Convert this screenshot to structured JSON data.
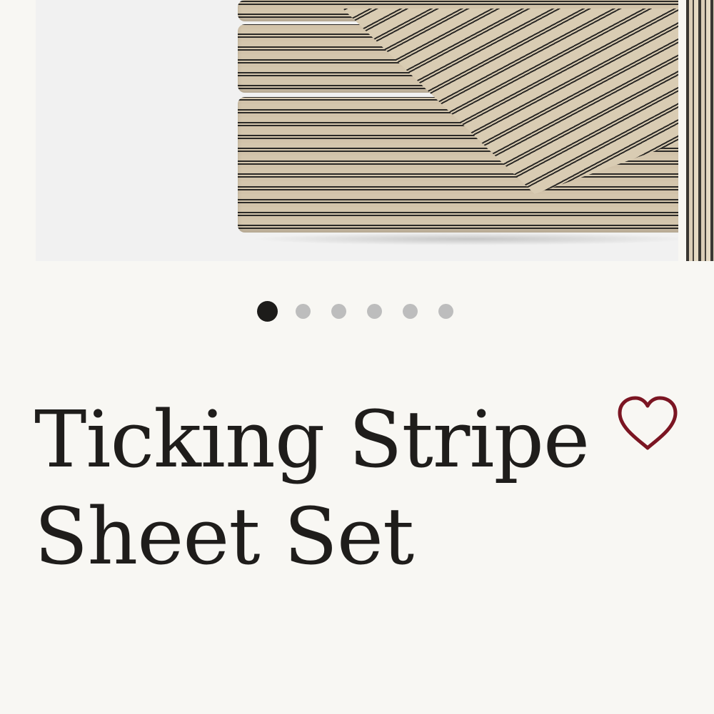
{
  "product": {
    "title": "Ticking Stripe Sheet Set"
  },
  "carousel": {
    "image_description": "Folded ticking stripe sheet set",
    "slide_count": 6,
    "active_index": 0
  },
  "icons": {
    "favorite": "heart-icon"
  },
  "colors": {
    "background": "#f8f7f3",
    "title": "#1f1d1b",
    "heart": "#7b1522",
    "dot_active": "#1d1c1a",
    "dot_inactive": "#bdbdbd"
  }
}
